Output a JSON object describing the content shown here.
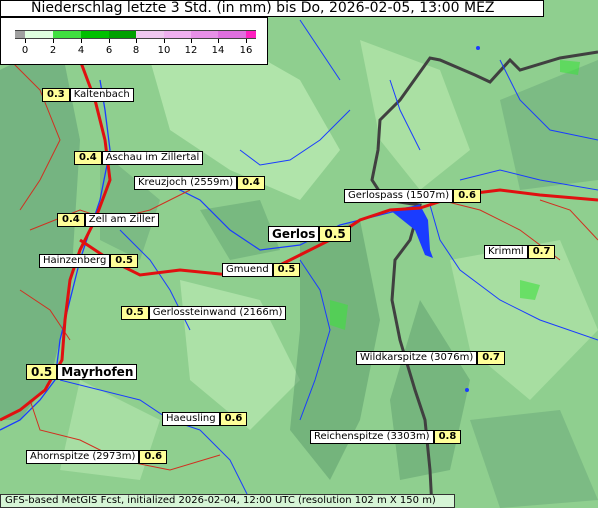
{
  "title": "Niederschlag letzte 3 Std. (in mm) bis Do, 2026-02-05, 13:00 MEZ",
  "legend": {
    "ticks": [
      "0",
      "2",
      "4",
      "6",
      "8",
      "10",
      "12",
      "14",
      "16"
    ],
    "colors": {
      "below0": "#a0a0a0",
      "0-2": "#e0ffe0",
      "2-4": "#40e040",
      "4-6": "#00c000",
      "6-8": "#00a000",
      "8-10": "#f0c8f0",
      "10-12": "#f0b0f0",
      "12-14": "#e890e8",
      "14-16": "#e070e0",
      "above16": "#ff20c0"
    }
  },
  "places": [
    {
      "name": "Kaltenbach",
      "value": "0.3"
    },
    {
      "name": "Aschau im Zillertal",
      "value": "0.4"
    },
    {
      "name": "Kreuzjoch (2559m)",
      "value": "0.4"
    },
    {
      "name": "Zell am Ziller",
      "value": "0.4"
    },
    {
      "name": "Gerlospass (1507m)",
      "value": "0.6"
    },
    {
      "name": "Gerlos",
      "value": "0.5"
    },
    {
      "name": "Hainzenberg",
      "value": "0.5"
    },
    {
      "name": "Gmuend",
      "value": "0.5"
    },
    {
      "name": "Krimml",
      "value": "0.7"
    },
    {
      "name": "Gerlossteinwand (2166m)",
      "value": "0.5"
    },
    {
      "name": "Mayrhofen",
      "value": "0.5"
    },
    {
      "name": "Wildkarspitze (3076m)",
      "value": "0.7"
    },
    {
      "name": "Haeusling",
      "value": "0.6"
    },
    {
      "name": "Reichenspitze (3303m)",
      "value": "0.8"
    },
    {
      "name": "Ahornspitze (2973m)",
      "value": "0.6"
    }
  ],
  "footer": "GFS-based MetGIS Fcst, initialized 2026-02-04, 12:00 UTC  (resolution 102 m X 150 m)",
  "colors": {
    "terrain_base": "#8fcf8f",
    "terrain_light": "#b8e8b0",
    "terrain_dark": "#5e9e6e",
    "river": "#1a3cff",
    "road_main": "#e01010",
    "road_minor": "#d03020",
    "border": "#404040",
    "lake": "#1a3cff"
  }
}
